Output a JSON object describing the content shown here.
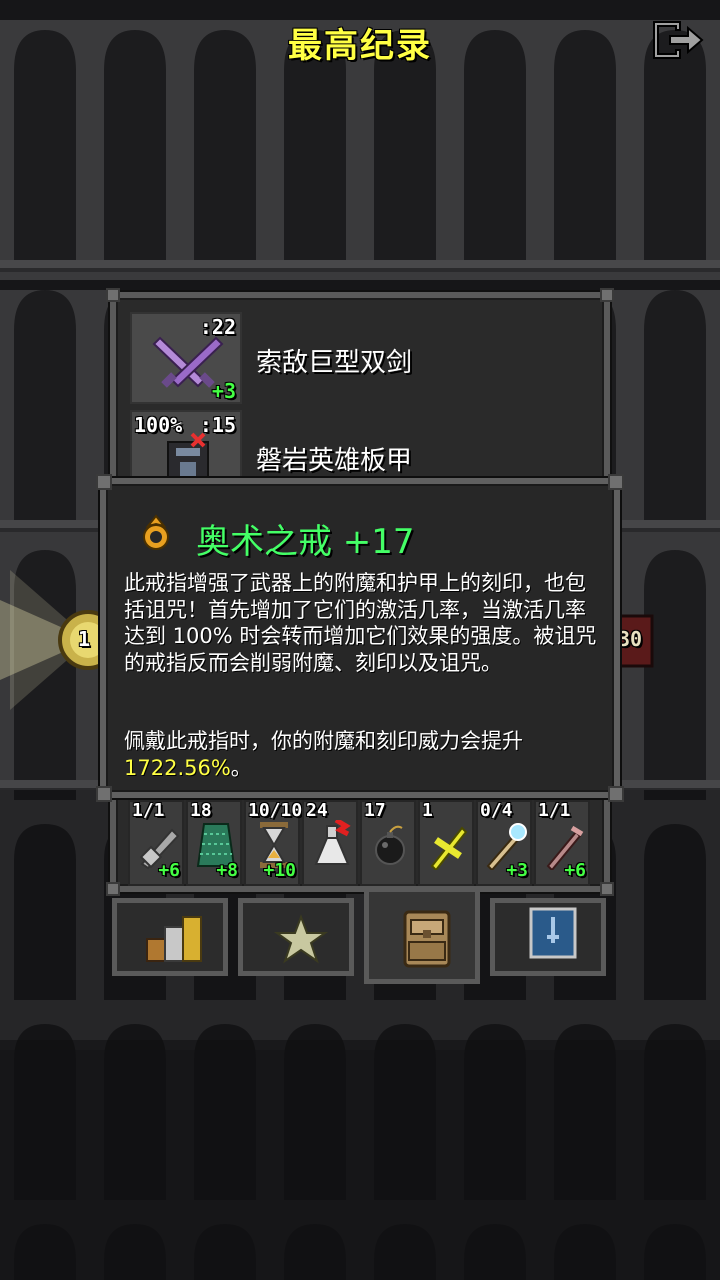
{
  "header": {
    "title": "最高纪录",
    "exit_icon": "exit-icon"
  },
  "equipment": [
    {
      "name": "索敌巨型双剑",
      "icon": "twin-swords-icon",
      "top_right": ":22",
      "top_left": "",
      "bonus": "+3"
    },
    {
      "name": "磐岩英雄板甲",
      "icon": "plate-armor-icon",
      "top_right": ":15",
      "top_left": "100%",
      "bonus": ""
    }
  ],
  "side": {
    "left_badge": "1",
    "right_badge": "30"
  },
  "popup": {
    "icon": "ring-icon",
    "title": "奥术之戒 +17",
    "description": "此戒指增强了武器上的附魔和护甲上的刻印，也包括诅咒！首先增加了它们的激活几率，当激活几率达到 100% 时会转而增加它们效果的强度。被诅咒的戒指反而会削弱附魔、刻印以及诅咒。",
    "effect_prefix": "佩戴此戒指时，你的附魔和刻印威力会提升",
    "effect_value": "1722.56%",
    "effect_suffix": "。",
    "highlight_color": "#ffff44",
    "title_color": "#44ff66"
  },
  "quickslots": [
    {
      "icon": "wand-grey-icon",
      "top": "1/1",
      "bottom": "+6"
    },
    {
      "icon": "cloak-green-icon",
      "top": "18",
      "bottom": "+8"
    },
    {
      "icon": "hourglass-icon",
      "top": "10/10",
      "bottom": "+10"
    },
    {
      "icon": "flask-icon",
      "top": "24",
      "bottom": ""
    },
    {
      "icon": "bomb-icon",
      "top": "17",
      "bottom": ""
    },
    {
      "icon": "gold-cross-icon",
      "top": "1",
      "bottom": ""
    },
    {
      "icon": "crystal-wand-icon",
      "top": "0/4",
      "bottom": "+3"
    },
    {
      "icon": "pink-wand-icon",
      "top": "1/1",
      "bottom": "+6"
    }
  ],
  "tabs": [
    {
      "name": "stats",
      "icon": "stats-bars-icon",
      "active": false
    },
    {
      "name": "badges",
      "icon": "star-icon",
      "active": false
    },
    {
      "name": "items",
      "icon": "backpack-icon",
      "active": true
    },
    {
      "name": "journal",
      "icon": "journal-icon",
      "active": false
    }
  ]
}
